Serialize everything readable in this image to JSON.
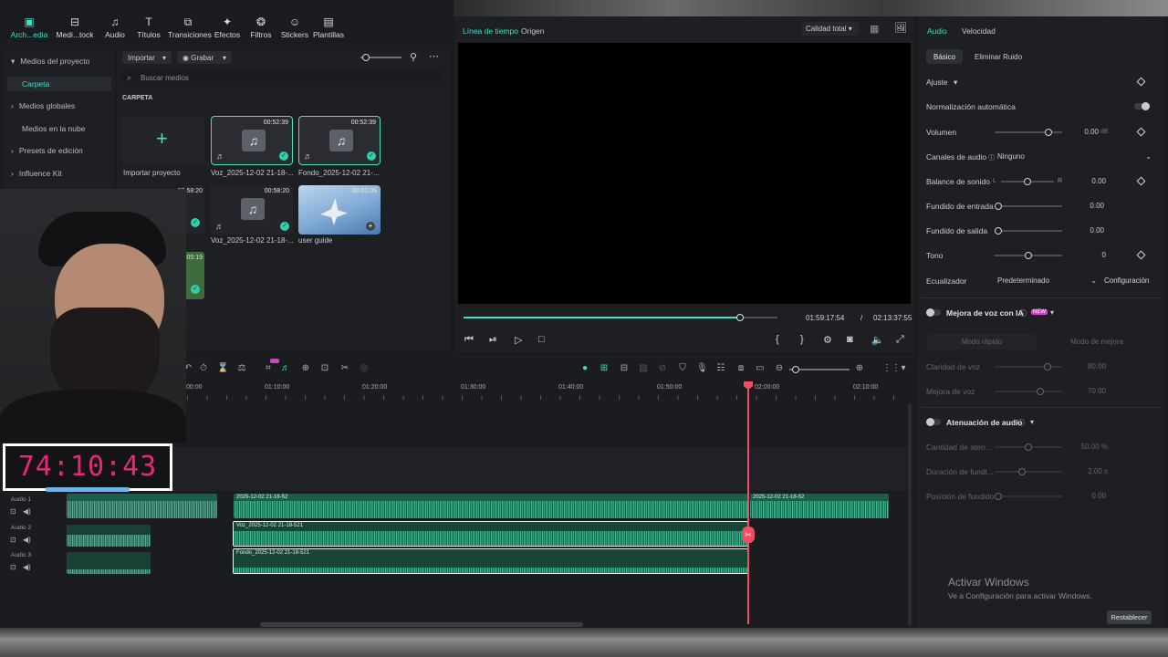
{
  "top_tabs": [
    {
      "label": "Arch...edia",
      "icon": "media-icon"
    },
    {
      "label": "Medi...tock",
      "icon": "stock-media-icon"
    },
    {
      "label": "Audio",
      "icon": "music-note-icon"
    },
    {
      "label": "Títulos",
      "icon": "text-icon"
    },
    {
      "label": "Transiciones",
      "icon": "transition-icon"
    },
    {
      "label": "Efectos",
      "icon": "effects-icon"
    },
    {
      "label": "Filtros",
      "icon": "filter-icon"
    },
    {
      "label": "Stickers",
      "icon": "sticker-icon"
    },
    {
      "label": "Plantillas",
      "icon": "template-icon"
    }
  ],
  "sidebar": {
    "items": [
      {
        "label": "Medios del proyecto",
        "arrow": "▾"
      },
      {
        "label": "Carpeta",
        "arrow": ""
      },
      {
        "label": "Medios globales",
        "arrow": "›"
      },
      {
        "label": "Medios en la nube",
        "arrow": ""
      },
      {
        "label": "Presets de edición",
        "arrow": "›"
      },
      {
        "label": "Influence Kit",
        "arrow": "›"
      }
    ]
  },
  "media": {
    "import_label": "Importar",
    "record_label": "Grabar",
    "search_placeholder": "Buscar medios",
    "folder_heading": "CARPETA",
    "import_project_label": "Importar proyecto",
    "cards": [
      {
        "name": "Voz_2025-12-02 21-18-...",
        "duration": "00:52:39"
      },
      {
        "name": "Fondo_2025-12-02 21-...",
        "duration": "00:52:39"
      },
      {
        "name": "Voz_2025-12-02 21-18-...",
        "duration": "00:58:20"
      },
      {
        "name": "user guide",
        "duration": "00:00:05"
      }
    ],
    "partial_durations": [
      "00:58:20",
      "00:05:19"
    ]
  },
  "preview": {
    "tab_timeline": "Línea de tiempo",
    "tab_source": "Origen",
    "quality": "Calidad total",
    "current_time": "01:59:17:54",
    "separator": "/",
    "total_time": "02:13:37:55",
    "progress": 0.88
  },
  "webcam_timer": "74:10:43",
  "timeline": {
    "ruler": [
      "00:00",
      "01:10:00",
      "01:20:00",
      "01:30:00",
      "01:40:00",
      "01:50:00",
      "02:00:00",
      "02:10:00"
    ],
    "tracks": [
      "Audio 1",
      "Audio 2",
      "Audio 3"
    ],
    "clips": {
      "a1_main": "2025-12-02 21-18-52",
      "a1_tail": "2025-12-02 21-18-52",
      "a2": "Voz_2025-12-02 21-18-521",
      "a3": "Fondo_2025-12-02 21-18-521"
    }
  },
  "props": {
    "tab_audio": "Audio",
    "tab_speed": "Velocidad",
    "sub_basic": "Básico",
    "sub_noise": "Eliminar Ruido",
    "section_adjust": "Ajuste",
    "auto_normalize": "Normalización automática",
    "volume_label": "Volumen",
    "volume_value": "0.00",
    "volume_unit": "dB",
    "channels_label": "Canales de audio",
    "channels_value": "Ninguno",
    "balance_label": "Balance de sonido",
    "balance_l": "L",
    "balance_r": "R",
    "balance_value": "0.00",
    "fade_in_label": "Fundido de entrada",
    "fade_in_value": "0.00",
    "fade_out_label": "Fundido  de salida",
    "fade_out_value": "0.00",
    "tone_label": "Tono",
    "tone_value": "0",
    "eq_label": "Ecualizador",
    "eq_value": "Predeterminado",
    "eq_config": "Configuración",
    "voice_ai_label": "Mejora de voz con IA",
    "new_badge": "NEW",
    "mode_fast": "Modo rápido",
    "mode_better": "Modo de mejora",
    "voice_clarity": "Claridad de voz",
    "voice_clarity_value": "80.00",
    "voice_improve": "Mejora de voz",
    "voice_improve_value": "70.00",
    "ducking_label": "Atenuación de audio",
    "duck_amount": "Cantidad de aten...",
    "duck_amount_value": "50.00 %",
    "duck_duration": "Duración de fundi...",
    "duck_duration_value": "2.00 s",
    "duck_position": "Posición de fundido",
    "duck_position_value": "0.00",
    "reset_button": "Restablecer"
  },
  "windows_watermark": {
    "title": "Activar Windows",
    "subtitle": "Ve a Configuración para activar Windows."
  }
}
